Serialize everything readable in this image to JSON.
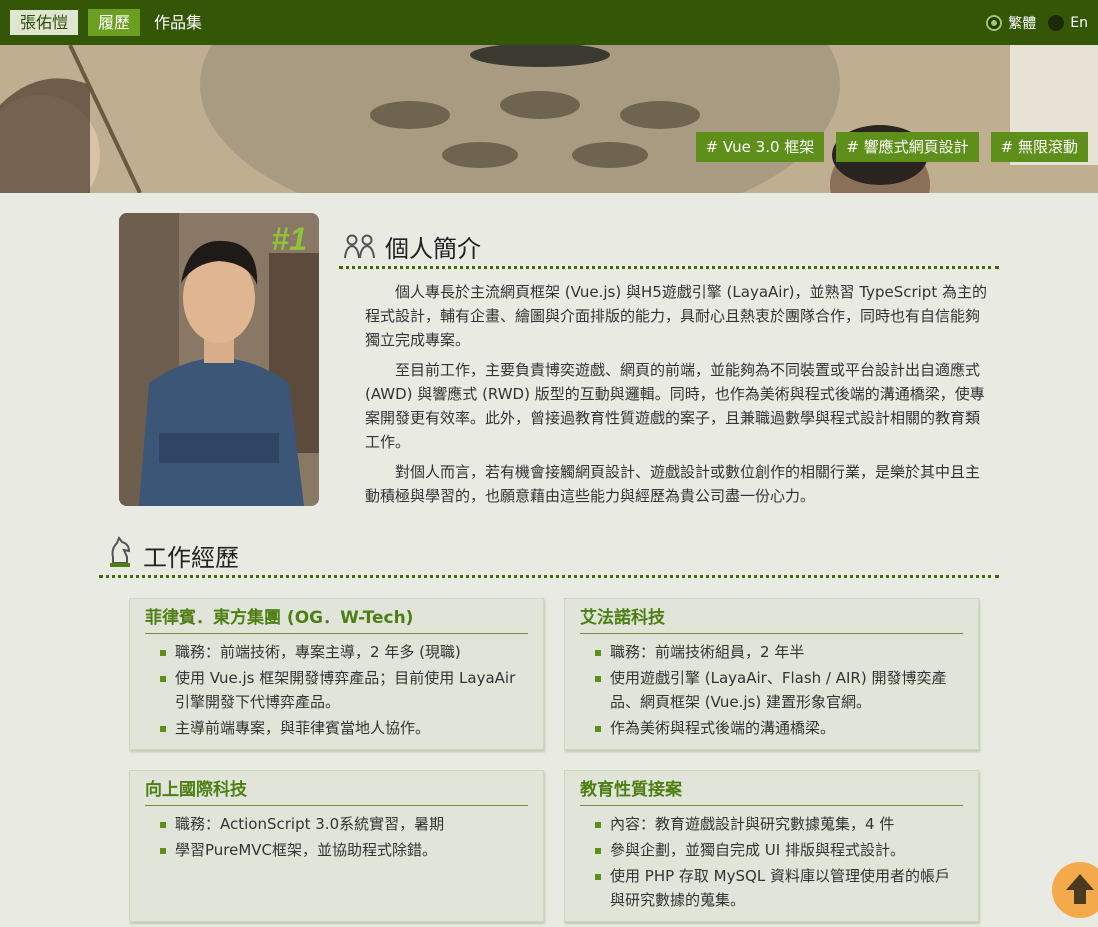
{
  "nav": {
    "brand": "張佑愷",
    "items": [
      "履歷",
      "作品集"
    ],
    "lang": [
      "繁體",
      "En"
    ]
  },
  "banner": {
    "tags": [
      "# Vue 3.0 框架",
      "# 響應式網頁設計",
      "# 無限滾動"
    ]
  },
  "profile": {
    "badge": "#1",
    "title": "個人簡介",
    "paragraphs": [
      "個人專長於主流網頁框架 (Vue.js) 與H5遊戲引擎 (LayaAir)，並熟習 TypeScript 為主的程式設計，輔有企畫、繪圖與介面排版的能力，具耐心且熱衷於團隊合作，同時也有自信能夠獨立完成專案。",
      "至目前工作，主要負責博奕遊戲、網頁的前端，並能夠為不同裝置或平台設計出自適應式 (AWD) 與響應式 (RWD) 版型的互動與邏輯。同時，也作為美術與程式後端的溝通橋梁，使專案開發更有效率。此外，曾接過教育性質遊戲的案子，且兼職過數學與程式設計相關的教育類工作。",
      "對個人而言，若有機會接觸網頁設計、遊戲設計或數位創作的相關行業，是樂於其中且主動積極與學習的，也願意藉由這些能力與經歷為貴公司盡一份心力。"
    ]
  },
  "work": {
    "title": "工作經歷",
    "cards": [
      {
        "name": "菲律賓．東方集團 (OG．W-Tech)",
        "items": [
          "職務：前端技術，專案主導，2 年多 (現職)",
          "使用 Vue.js 框架開發博弈產品；目前使用 LayaAir 引擎開發下代博弈產品。",
          "主導前端專案，與菲律賓當地人協作。"
        ]
      },
      {
        "name": "艾法諾科技",
        "items": [
          "職務：前端技術組員，2 年半",
          "使用遊戲引擎 (LayaAir、Flash / AIR) 開發博奕產品、網頁框架 (Vue.js) 建置形象官網。",
          "作為美術與程式後端的溝通橋梁。"
        ]
      },
      {
        "name": "向上國際科技",
        "items": [
          "職務：ActionScript 3.0系統實習，暑期",
          "學習PureMVC框架，並協助程式除錯。"
        ]
      },
      {
        "name": "教育性質接案",
        "items": [
          "內容：教育遊戲設計與研究數據蒐集，4 件",
          "參與企劃，並獨自完成 UI 排版與程式設計。",
          "使用 PHP 存取 MySQL 資料庫以管理使用者的帳戶與研究數據的蒐集。"
        ]
      }
    ]
  },
  "colors": {
    "topbar": "#335607",
    "accent": "#5e8f1b",
    "scroll_button": "#f4a94b"
  },
  "icons": [
    "people-icon",
    "chess-knight-icon",
    "arrow-up-icon"
  ]
}
